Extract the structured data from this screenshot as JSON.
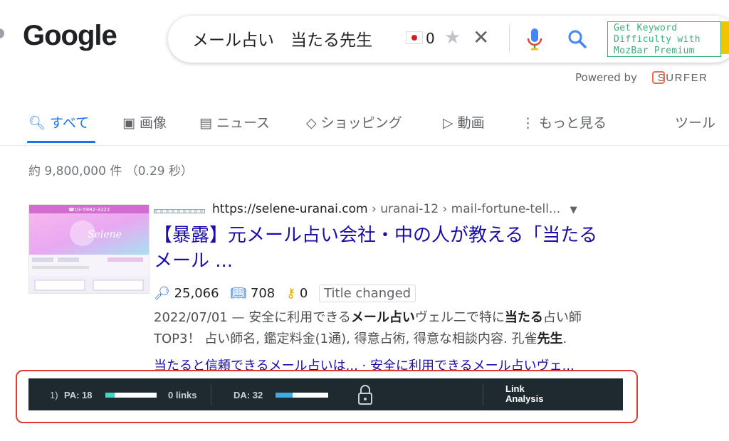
{
  "logo": {
    "text": "Google"
  },
  "search": {
    "query": "メール占い　当たる先生",
    "count": "0",
    "mozbar_promo": [
      "Get Keyword",
      "Difficulty with",
      "MozBar Premium"
    ],
    "powered_by": "Powered by",
    "surfer": "SURFER"
  },
  "tabs": [
    {
      "label": "すべて",
      "icon": "search-icon"
    },
    {
      "label": "画像",
      "icon": "image-icon"
    },
    {
      "label": "ニュース",
      "icon": "news-icon"
    },
    {
      "label": "ショッピング",
      "icon": "tag-icon"
    },
    {
      "label": "動画",
      "icon": "video-icon"
    },
    {
      "label": "もっと見る",
      "icon": "more-dots-icon"
    },
    {
      "label": "ツール"
    }
  ],
  "stats": "約 9,800,000 件 （0.29 秒）",
  "result": {
    "url": "https://selene-uranai.com",
    "crumbs": " › uranai-12 › mail-fortune-tell...",
    "title_line1": "【暴露】元メール占い会社・中の人が教える「当たる",
    "title_line2": "メール ...",
    "metric1": "25,066",
    "metric2": "708",
    "metric3": "0",
    "badge": "Title changed",
    "date": "2022/07/01 — ",
    "snip_a": "安全に利用できる",
    "snip_b": "メール占い",
    "snip_c": "ヴェル二で特に",
    "snip_d": "当たる",
    "snip_e": "占い師",
    "snip_f": "TOP3！ 占い師名, 鑑定料金(1通), 得意占術, 得意な相談内容. 孔雀",
    "snip_g": "先生",
    "snip_h": ".",
    "sitelinks": "当たると信頼できるメール占いは... · 安全に利用できるメール占いヴェ...",
    "thumb_phone": "☎03-5992-3222",
    "thumb_brand": "Selene"
  },
  "mozbar": {
    "rank": "1)",
    "pa_label": "PA: 18",
    "pa_value": 18,
    "links": "0 links",
    "da_label": "DA: 32",
    "da_value": 32,
    "link_analysis_1": "Link",
    "link_analysis_2": "Analysis",
    "colors": {
      "pa": "#3fd6c6",
      "da": "#3fa9e0"
    }
  }
}
